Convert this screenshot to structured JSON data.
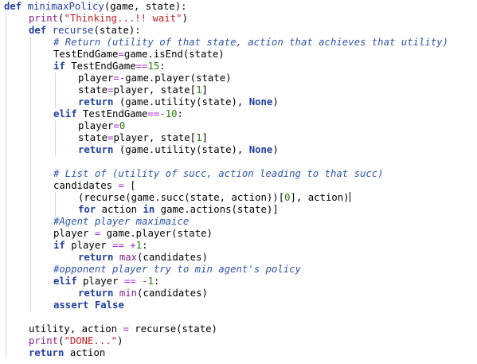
{
  "colors": {
    "keyword": "#1f3fa3",
    "function_name": "#1f3fa3",
    "builtin": "#8b1f8f",
    "string": "#c42027",
    "number": "#2b7a0b",
    "comment": "#2f56a9",
    "operator": "#a428d0",
    "text": "#000000"
  },
  "code": {
    "lines": [
      {
        "indent": 0,
        "tokens": [
          {
            "t": "def",
            "c": "keyword",
            "b": true
          },
          {
            "t": " "
          },
          {
            "t": "minimaxPolicy",
            "c": "function_name"
          },
          {
            "t": "(game, state):"
          }
        ]
      },
      {
        "indent": 1,
        "tokens": [
          {
            "t": "print",
            "c": "builtin"
          },
          {
            "t": "("
          },
          {
            "t": "\"Thinking...!! wait\"",
            "c": "string"
          },
          {
            "t": ")"
          }
        ]
      },
      {
        "indent": 1,
        "tokens": [
          {
            "t": "def",
            "c": "keyword",
            "b": true
          },
          {
            "t": " "
          },
          {
            "t": "recurse",
            "c": "function_name"
          },
          {
            "t": "(state):"
          }
        ]
      },
      {
        "indent": 2,
        "tokens": [
          {
            "t": "# Return (utility of that state, action that achieves that utility)",
            "c": "comment",
            "i": true
          }
        ]
      },
      {
        "indent": 2,
        "tokens": [
          {
            "t": "TestEndGame"
          },
          {
            "t": "=",
            "c": "operator"
          },
          {
            "t": "game.isEnd(state)"
          }
        ]
      },
      {
        "indent": 2,
        "tokens": [
          {
            "t": "if",
            "c": "keyword",
            "b": true
          },
          {
            "t": " TestEndGame"
          },
          {
            "t": "==",
            "c": "operator"
          },
          {
            "t": "15",
            "c": "number"
          },
          {
            "t": ":"
          }
        ]
      },
      {
        "indent": 3,
        "tokens": [
          {
            "t": "player"
          },
          {
            "t": "=-",
            "c": "operator"
          },
          {
            "t": "game.player(state)"
          }
        ]
      },
      {
        "indent": 3,
        "tokens": [
          {
            "t": "state"
          },
          {
            "t": "=",
            "c": "operator"
          },
          {
            "t": "player, state["
          },
          {
            "t": "1",
            "c": "number"
          },
          {
            "t": "]"
          }
        ]
      },
      {
        "indent": 3,
        "tokens": [
          {
            "t": "return",
            "c": "keyword",
            "b": true
          },
          {
            "t": " (game.utility(state), "
          },
          {
            "t": "None",
            "c": "keyword",
            "b": true
          },
          {
            "t": ")"
          }
        ]
      },
      {
        "indent": 2,
        "tokens": [
          {
            "t": "elif",
            "c": "keyword",
            "b": true
          },
          {
            "t": " TestEndGame"
          },
          {
            "t": "==-",
            "c": "operator"
          },
          {
            "t": "10",
            "c": "number"
          },
          {
            "t": ":"
          }
        ]
      },
      {
        "indent": 3,
        "tokens": [
          {
            "t": "player"
          },
          {
            "t": "=",
            "c": "operator"
          },
          {
            "t": "0",
            "c": "number"
          }
        ]
      },
      {
        "indent": 3,
        "tokens": [
          {
            "t": "state"
          },
          {
            "t": "=",
            "c": "operator"
          },
          {
            "t": "player, state["
          },
          {
            "t": "1",
            "c": "number"
          },
          {
            "t": "]"
          }
        ]
      },
      {
        "indent": 3,
        "tokens": [
          {
            "t": "return",
            "c": "keyword",
            "b": true
          },
          {
            "t": " (game.utility(state), "
          },
          {
            "t": "None",
            "c": "keyword",
            "b": true
          },
          {
            "t": ")"
          }
        ]
      },
      {
        "indent": 0,
        "tokens": []
      },
      {
        "indent": 2,
        "tokens": [
          {
            "t": "# List of (utility of succ, action leading to that succ)",
            "c": "comment",
            "i": true
          }
        ]
      },
      {
        "indent": 2,
        "tokens": [
          {
            "t": "candidates "
          },
          {
            "t": "=",
            "c": "operator"
          },
          {
            "t": " ["
          }
        ]
      },
      {
        "indent": 3,
        "caret": true,
        "tokens": [
          {
            "t": "(recurse(game.succ(state, action))["
          },
          {
            "t": "0",
            "c": "number"
          },
          {
            "t": "], action)"
          }
        ]
      },
      {
        "indent": 3,
        "tokens": [
          {
            "t": "for",
            "c": "keyword",
            "b": true
          },
          {
            "t": " action "
          },
          {
            "t": "in",
            "c": "keyword",
            "b": true
          },
          {
            "t": " game.actions(state)]"
          }
        ]
      },
      {
        "indent": 2,
        "tokens": [
          {
            "t": "#Agent player maximaice",
            "c": "comment",
            "i": true
          }
        ]
      },
      {
        "indent": 2,
        "tokens": [
          {
            "t": "player "
          },
          {
            "t": "=",
            "c": "operator"
          },
          {
            "t": " game.player(state)"
          }
        ]
      },
      {
        "indent": 2,
        "tokens": [
          {
            "t": "if",
            "c": "keyword",
            "b": true
          },
          {
            "t": " player "
          },
          {
            "t": "==",
            "c": "operator"
          },
          {
            "t": " "
          },
          {
            "t": "+",
            "c": "operator"
          },
          {
            "t": "1",
            "c": "number"
          },
          {
            "t": ":"
          }
        ]
      },
      {
        "indent": 3,
        "tokens": [
          {
            "t": "return",
            "c": "keyword",
            "b": true
          },
          {
            "t": " "
          },
          {
            "t": "max",
            "c": "builtin"
          },
          {
            "t": "(candidates)"
          }
        ]
      },
      {
        "indent": 2,
        "tokens": [
          {
            "t": "#opponent player try to min agent's policy",
            "c": "comment",
            "i": true
          }
        ]
      },
      {
        "indent": 2,
        "tokens": [
          {
            "t": "elif",
            "c": "keyword",
            "b": true
          },
          {
            "t": " player "
          },
          {
            "t": "==",
            "c": "operator"
          },
          {
            "t": " "
          },
          {
            "t": "-",
            "c": "operator"
          },
          {
            "t": "1",
            "c": "number"
          },
          {
            "t": ":"
          }
        ]
      },
      {
        "indent": 3,
        "tokens": [
          {
            "t": "return",
            "c": "keyword",
            "b": true
          },
          {
            "t": " "
          },
          {
            "t": "min",
            "c": "builtin"
          },
          {
            "t": "(candidates)"
          }
        ]
      },
      {
        "indent": 2,
        "tokens": [
          {
            "t": "assert",
            "c": "keyword",
            "b": true
          },
          {
            "t": " "
          },
          {
            "t": "False",
            "c": "keyword",
            "b": true
          }
        ]
      },
      {
        "indent": 0,
        "tokens": []
      },
      {
        "indent": 1,
        "tokens": [
          {
            "t": "utility, action "
          },
          {
            "t": "=",
            "c": "operator"
          },
          {
            "t": " recurse(state)"
          }
        ]
      },
      {
        "indent": 1,
        "tokens": [
          {
            "t": "print",
            "c": "builtin"
          },
          {
            "t": "("
          },
          {
            "t": "\"DONE...\"",
            "c": "string"
          },
          {
            "t": ")"
          }
        ]
      },
      {
        "indent": 1,
        "tokens": [
          {
            "t": "return",
            "c": "keyword",
            "b": true
          },
          {
            "t": " action"
          }
        ]
      }
    ]
  }
}
